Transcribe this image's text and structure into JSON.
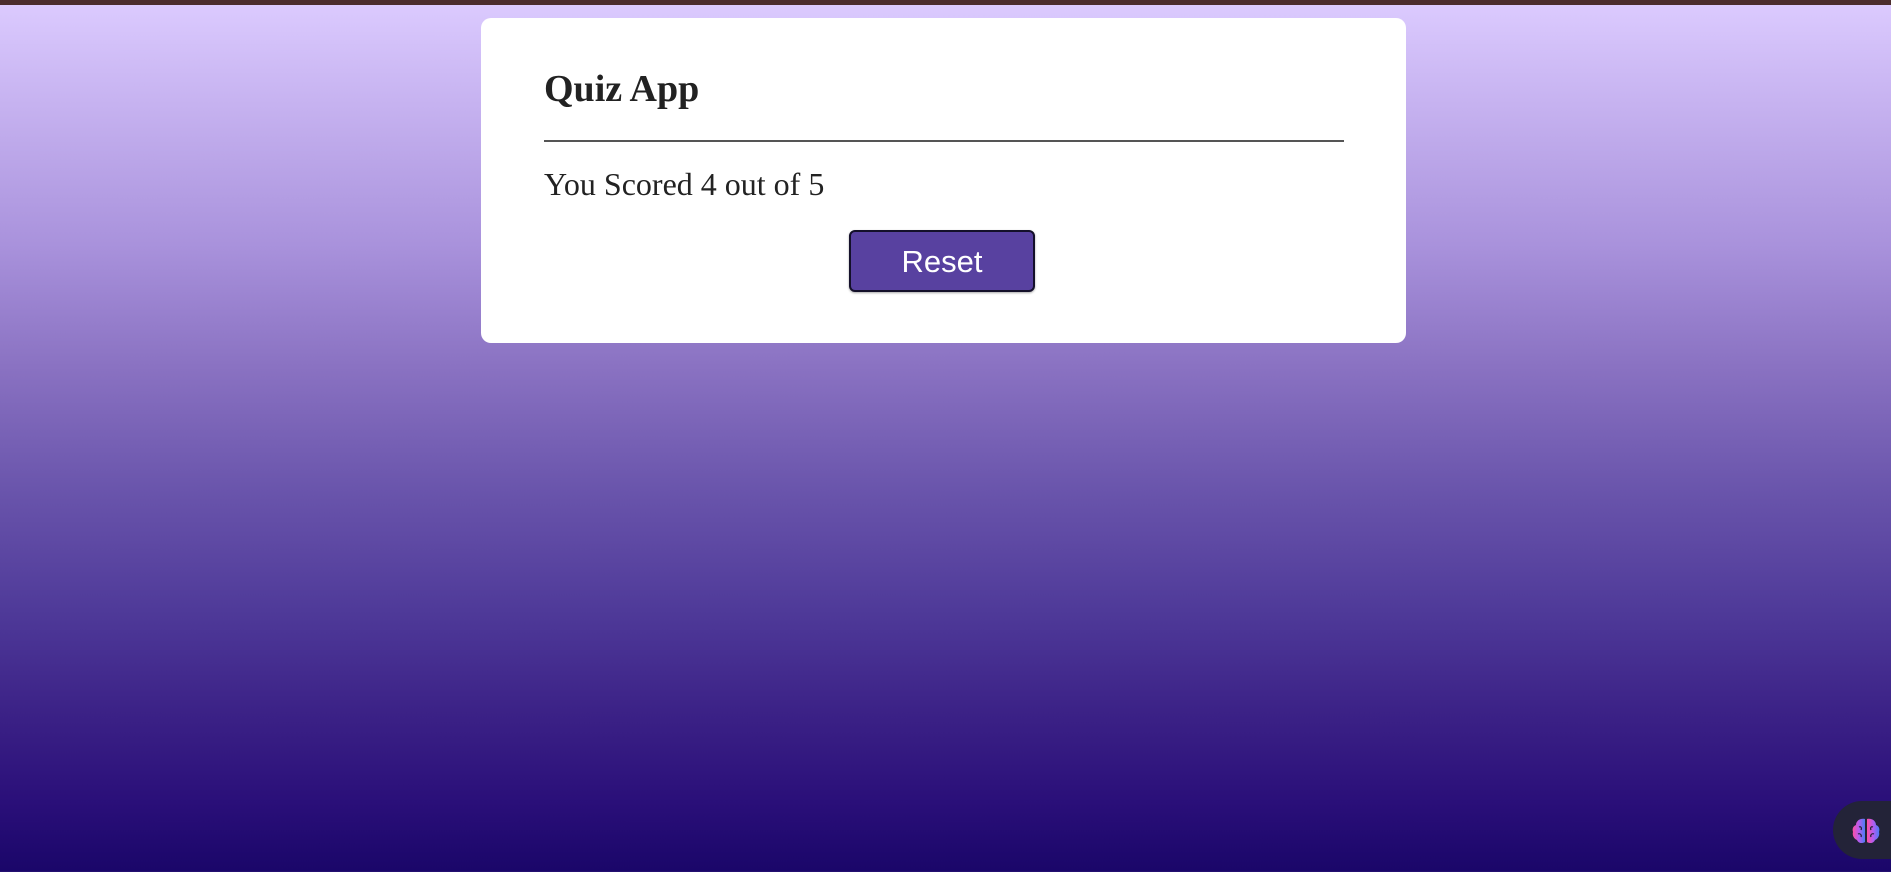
{
  "app": {
    "title": "Quiz App",
    "result_text": "You Scored 4 out of 5",
    "score": 4,
    "total": 5,
    "reset_label": "Reset"
  },
  "colors": {
    "card_background": "#ffffff",
    "button_background": "#5841a0",
    "button_text": "#ffffff",
    "gradient_top": "#dccbff",
    "gradient_bottom": "#1a0669",
    "top_strip": "#4b2d2d"
  },
  "overlay": {
    "icon": "brain-icon"
  }
}
